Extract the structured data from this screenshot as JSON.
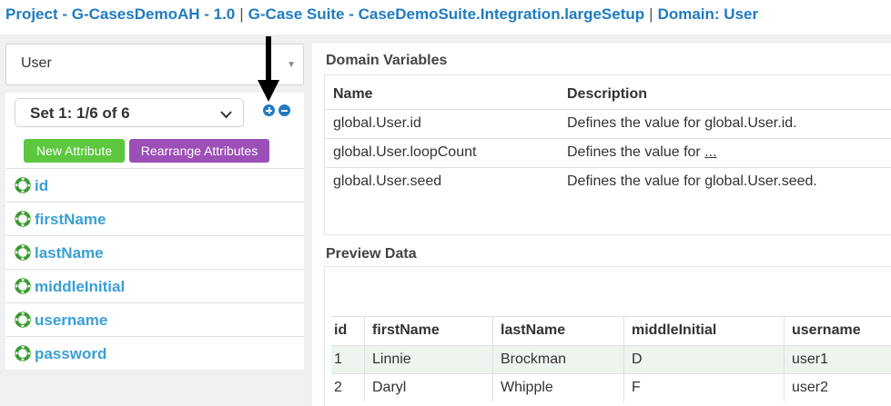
{
  "breadcrumb": {
    "project": "Project - G-CasesDemoAH - 1.0",
    "suite": "G-Case Suite - CaseDemoSuite.Integration.largeSetup",
    "domain": "Domain: User",
    "separator": "|"
  },
  "left": {
    "domain_select": "User",
    "set_select": "Set 1: 1/6 of 6",
    "new_attribute_label": "New Attribute",
    "rearrange_label": "Rearrange Attributes",
    "attributes": [
      "id",
      "firstName",
      "lastName",
      "middleInitial",
      "username",
      "password"
    ]
  },
  "right": {
    "domain_variables_title": "Domain Variables",
    "vars_headers": {
      "name": "Name",
      "description": "Description"
    },
    "vars_rows": [
      {
        "name": "global.User.id",
        "description": "Defines the value for global.User.id."
      },
      {
        "name": "global.User.loopCount",
        "description": "Defines the value for",
        "more": "..."
      },
      {
        "name": "global.User.seed",
        "description": "Defines the value for global.User.seed."
      }
    ],
    "preview_title": "Preview Data",
    "preview_headers": [
      "id",
      "firstName",
      "lastName",
      "middleInitial",
      "username"
    ],
    "preview_rows": [
      [
        "1",
        "Linnie",
        "Brockman",
        "D",
        "user1"
      ],
      [
        "2",
        "Daryl",
        "Whipple",
        "F",
        "user2"
      ]
    ]
  },
  "icons": {
    "attribute_icon": "lifebuoy-icon",
    "add_set": "plus-circle-icon",
    "remove_set": "minus-circle-icon",
    "annotation": "down-arrow"
  },
  "colors": {
    "link_blue": "#1f7bbf",
    "attribute_blue": "#3a9fd6",
    "attribute_icon_green": "#3a9b2f",
    "new_attribute_green": "#5cc73f",
    "rearrange_purple": "#9b4fb7"
  }
}
